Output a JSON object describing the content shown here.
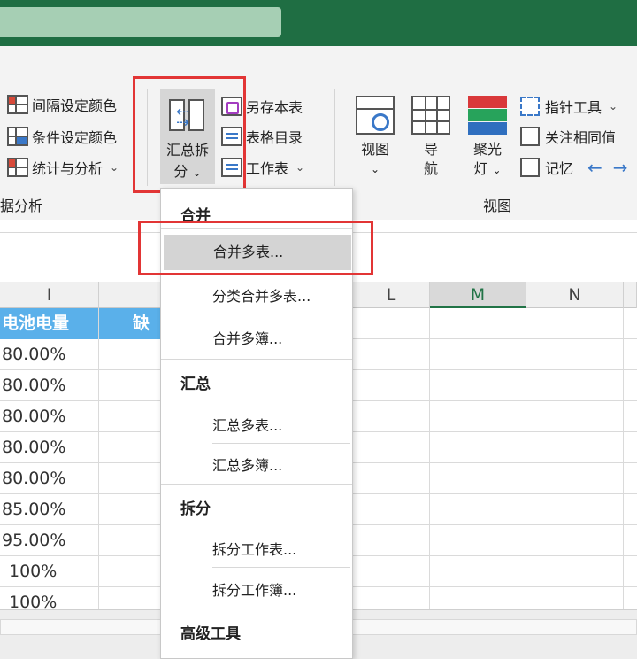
{
  "ribbon": {
    "data_analysis": {
      "items": [
        {
          "label": "间隔设定颜色",
          "icon": "grid-color-icon"
        },
        {
          "label": "条件设定颜色",
          "icon": "grid-condition-icon"
        },
        {
          "label": "统计与分析",
          "icon": "stats-icon",
          "dropdown": true
        }
      ],
      "group_label": "据分析"
    },
    "split_button": {
      "line1": "汇总拆",
      "line2": "分"
    },
    "save_items": [
      {
        "label": "另存本表",
        "icon": "save-sheet-icon"
      },
      {
        "label": "表格目录",
        "icon": "catalog-icon"
      },
      {
        "label": "工作表",
        "icon": "worksheet-icon",
        "dropdown": true
      }
    ],
    "view_group": {
      "view_line1": "视图",
      "nav_line1": "导",
      "nav_line2": "航",
      "spotlight_line1": "聚光",
      "spotlight_line2": "灯",
      "group_label": "视图",
      "pointer_tool": "指针工具",
      "focus_same": "关注相同值",
      "memory": "记忆"
    }
  },
  "columns": {
    "I": "I",
    "L": "L",
    "M": "M",
    "N": "N"
  },
  "table": {
    "header_col1": "电池电量",
    "header_col2": "缺指",
    "rows": [
      "80.00%",
      "80.00%",
      "80.00%",
      "80.00%",
      "80.00%",
      "85.00%",
      "95.00%",
      "100%",
      "100%"
    ]
  },
  "menu": {
    "sections": [
      {
        "title": "合并",
        "items": [
          "合并多表...",
          "分类合并多表...",
          "合并多簿..."
        ]
      },
      {
        "title": "汇总",
        "items": [
          "汇总多表...",
          "汇总多簿..."
        ]
      },
      {
        "title": "拆分",
        "items": [
          "拆分工作表...",
          "拆分工作簿..."
        ]
      },
      {
        "title": "高级工具",
        "items": []
      }
    ]
  },
  "colors": {
    "title_bar": "#1f6e43",
    "header_fill": "#5ab0ea",
    "highlight_box": "#e23535"
  }
}
